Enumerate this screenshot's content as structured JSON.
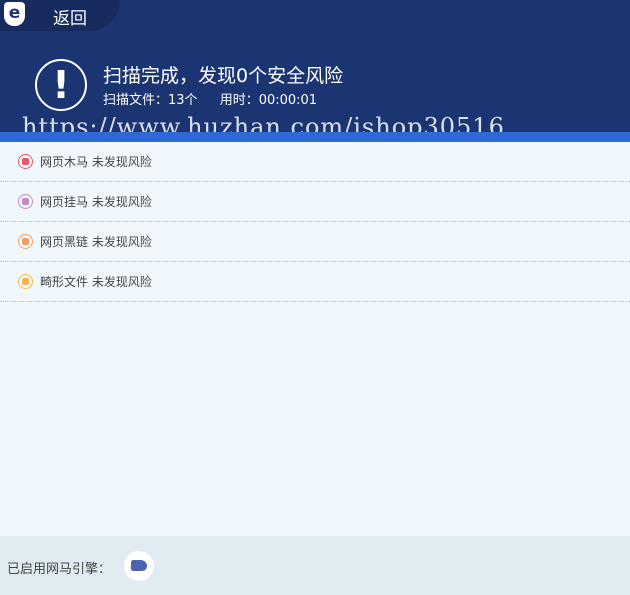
{
  "header": {
    "back_label": "返回",
    "logo": "e",
    "title": "扫描完成，发现0个安全风险",
    "files_scanned": "扫描文件：13个",
    "elapsed": "用时：00:00:01"
  },
  "watermark": "https://www.huzhan.com/ishop30516",
  "results": [
    {
      "name": "网页木马",
      "status": "未发现风险",
      "icon": "trojan-icon",
      "color": "#e8556a"
    },
    {
      "name": "网页挂马",
      "status": "未发现风险",
      "icon": "hang-icon",
      "color": "#c48ac8"
    },
    {
      "name": "网页黑链",
      "status": "未发现风险",
      "icon": "link-icon",
      "color": "#f0a066"
    },
    {
      "name": "畸形文件",
      "status": "未发现风险",
      "icon": "folder-icon",
      "color": "#f6b84a"
    }
  ],
  "footer": {
    "engine_label": "已启用网马引擎："
  }
}
